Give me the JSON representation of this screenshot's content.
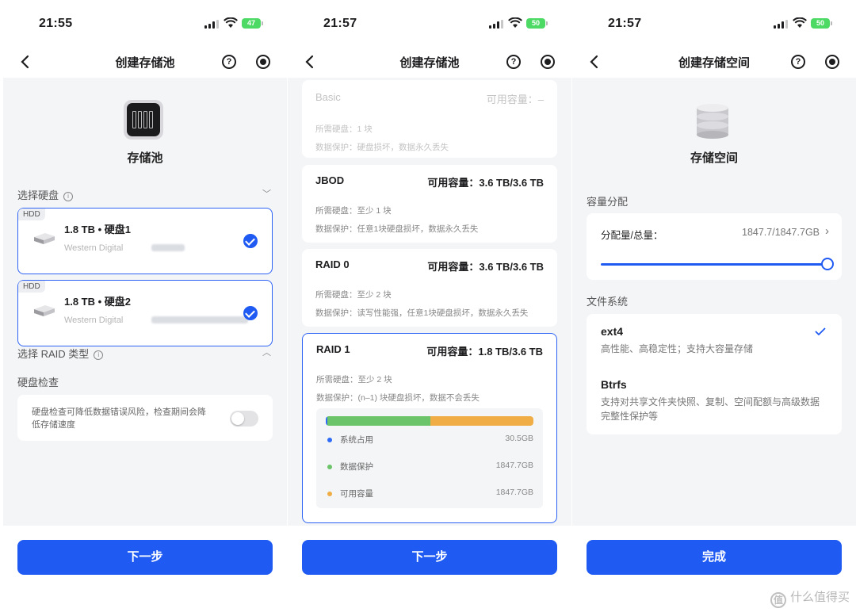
{
  "screens": [
    {
      "time": "21:55",
      "battery": "47",
      "title": "创建存储池",
      "icon_label": "存储池",
      "select_disk_label": "选择硬盘",
      "disks": [
        {
          "tag": "HDD",
          "name": "1.8 TB • 硬盘1",
          "vendor": "Western Digital"
        },
        {
          "tag": "HDD",
          "name": "1.8 TB • 硬盘2",
          "vendor": "Western Digital"
        }
      ],
      "raid_type_label": "选择 RAID 类型",
      "disk_check_label": "硬盘检查",
      "disk_check_desc": "硬盘检查可降低数据错误风险，检查期间会降低存储速度",
      "button": "下一步"
    },
    {
      "time": "21:57",
      "battery": "50",
      "title": "创建存储池",
      "raids": [
        {
          "name": "Basic",
          "capacity": "可用容量：–",
          "required": "所需硬盘：1 块",
          "protection": "数据保护：硬盘损坏，数据永久丢失"
        },
        {
          "name": "JBOD",
          "capacity": "可用容量：3.6 TB/3.6 TB",
          "required": "所需硬盘：至少 1 块",
          "protection": "数据保护：任意1块硬盘损坏，数据永久丢失"
        },
        {
          "name": "RAID 0",
          "capacity": "可用容量：3.6 TB/3.6 TB",
          "required": "所需硬盘：至少 2 块",
          "protection": "数据保护：读写性能强，任意1块硬盘损坏，数据永久丢失"
        },
        {
          "name": "RAID 1",
          "capacity": "可用容量：1.8 TB/3.6 TB",
          "required": "所需硬盘：至少 2 块",
          "protection": "数据保护：(n–1) 块硬盘损坏，数据不会丢失"
        }
      ],
      "usage": [
        {
          "label": "系统占用",
          "value": "30.5GB",
          "color": "#2f6bf6",
          "share": 0.008
        },
        {
          "label": "数据保护",
          "value": "1847.7GB",
          "color": "#6cc46a",
          "share": 0.496
        },
        {
          "label": "可用容量",
          "value": "1847.7GB",
          "color": "#f0ad45",
          "share": 0.496
        }
      ],
      "button": "下一步"
    },
    {
      "time": "21:57",
      "battery": "50",
      "title": "创建存储空间",
      "icon_label": "存储空间",
      "capacity_section": "容量分配",
      "allocation_label": "分配量/总量：",
      "allocation_value": "1847.7/1847.7GB",
      "allocation_fraction": 1.0,
      "fs_section": "文件系统",
      "filesystems": [
        {
          "name": "ext4",
          "desc": "高性能、高稳定性；支持大容量存储",
          "selected": true
        },
        {
          "name": "Btrfs",
          "desc": "支持对共享文件夹快照、复制、空间配额与高级数据完整性保护等",
          "selected": false
        }
      ],
      "button": "完成"
    }
  ],
  "watermark": {
    "logo": "值",
    "text": "什么值得买"
  },
  "colors": {
    "accent": "#1f5af3",
    "background": "#f4f5f7"
  }
}
